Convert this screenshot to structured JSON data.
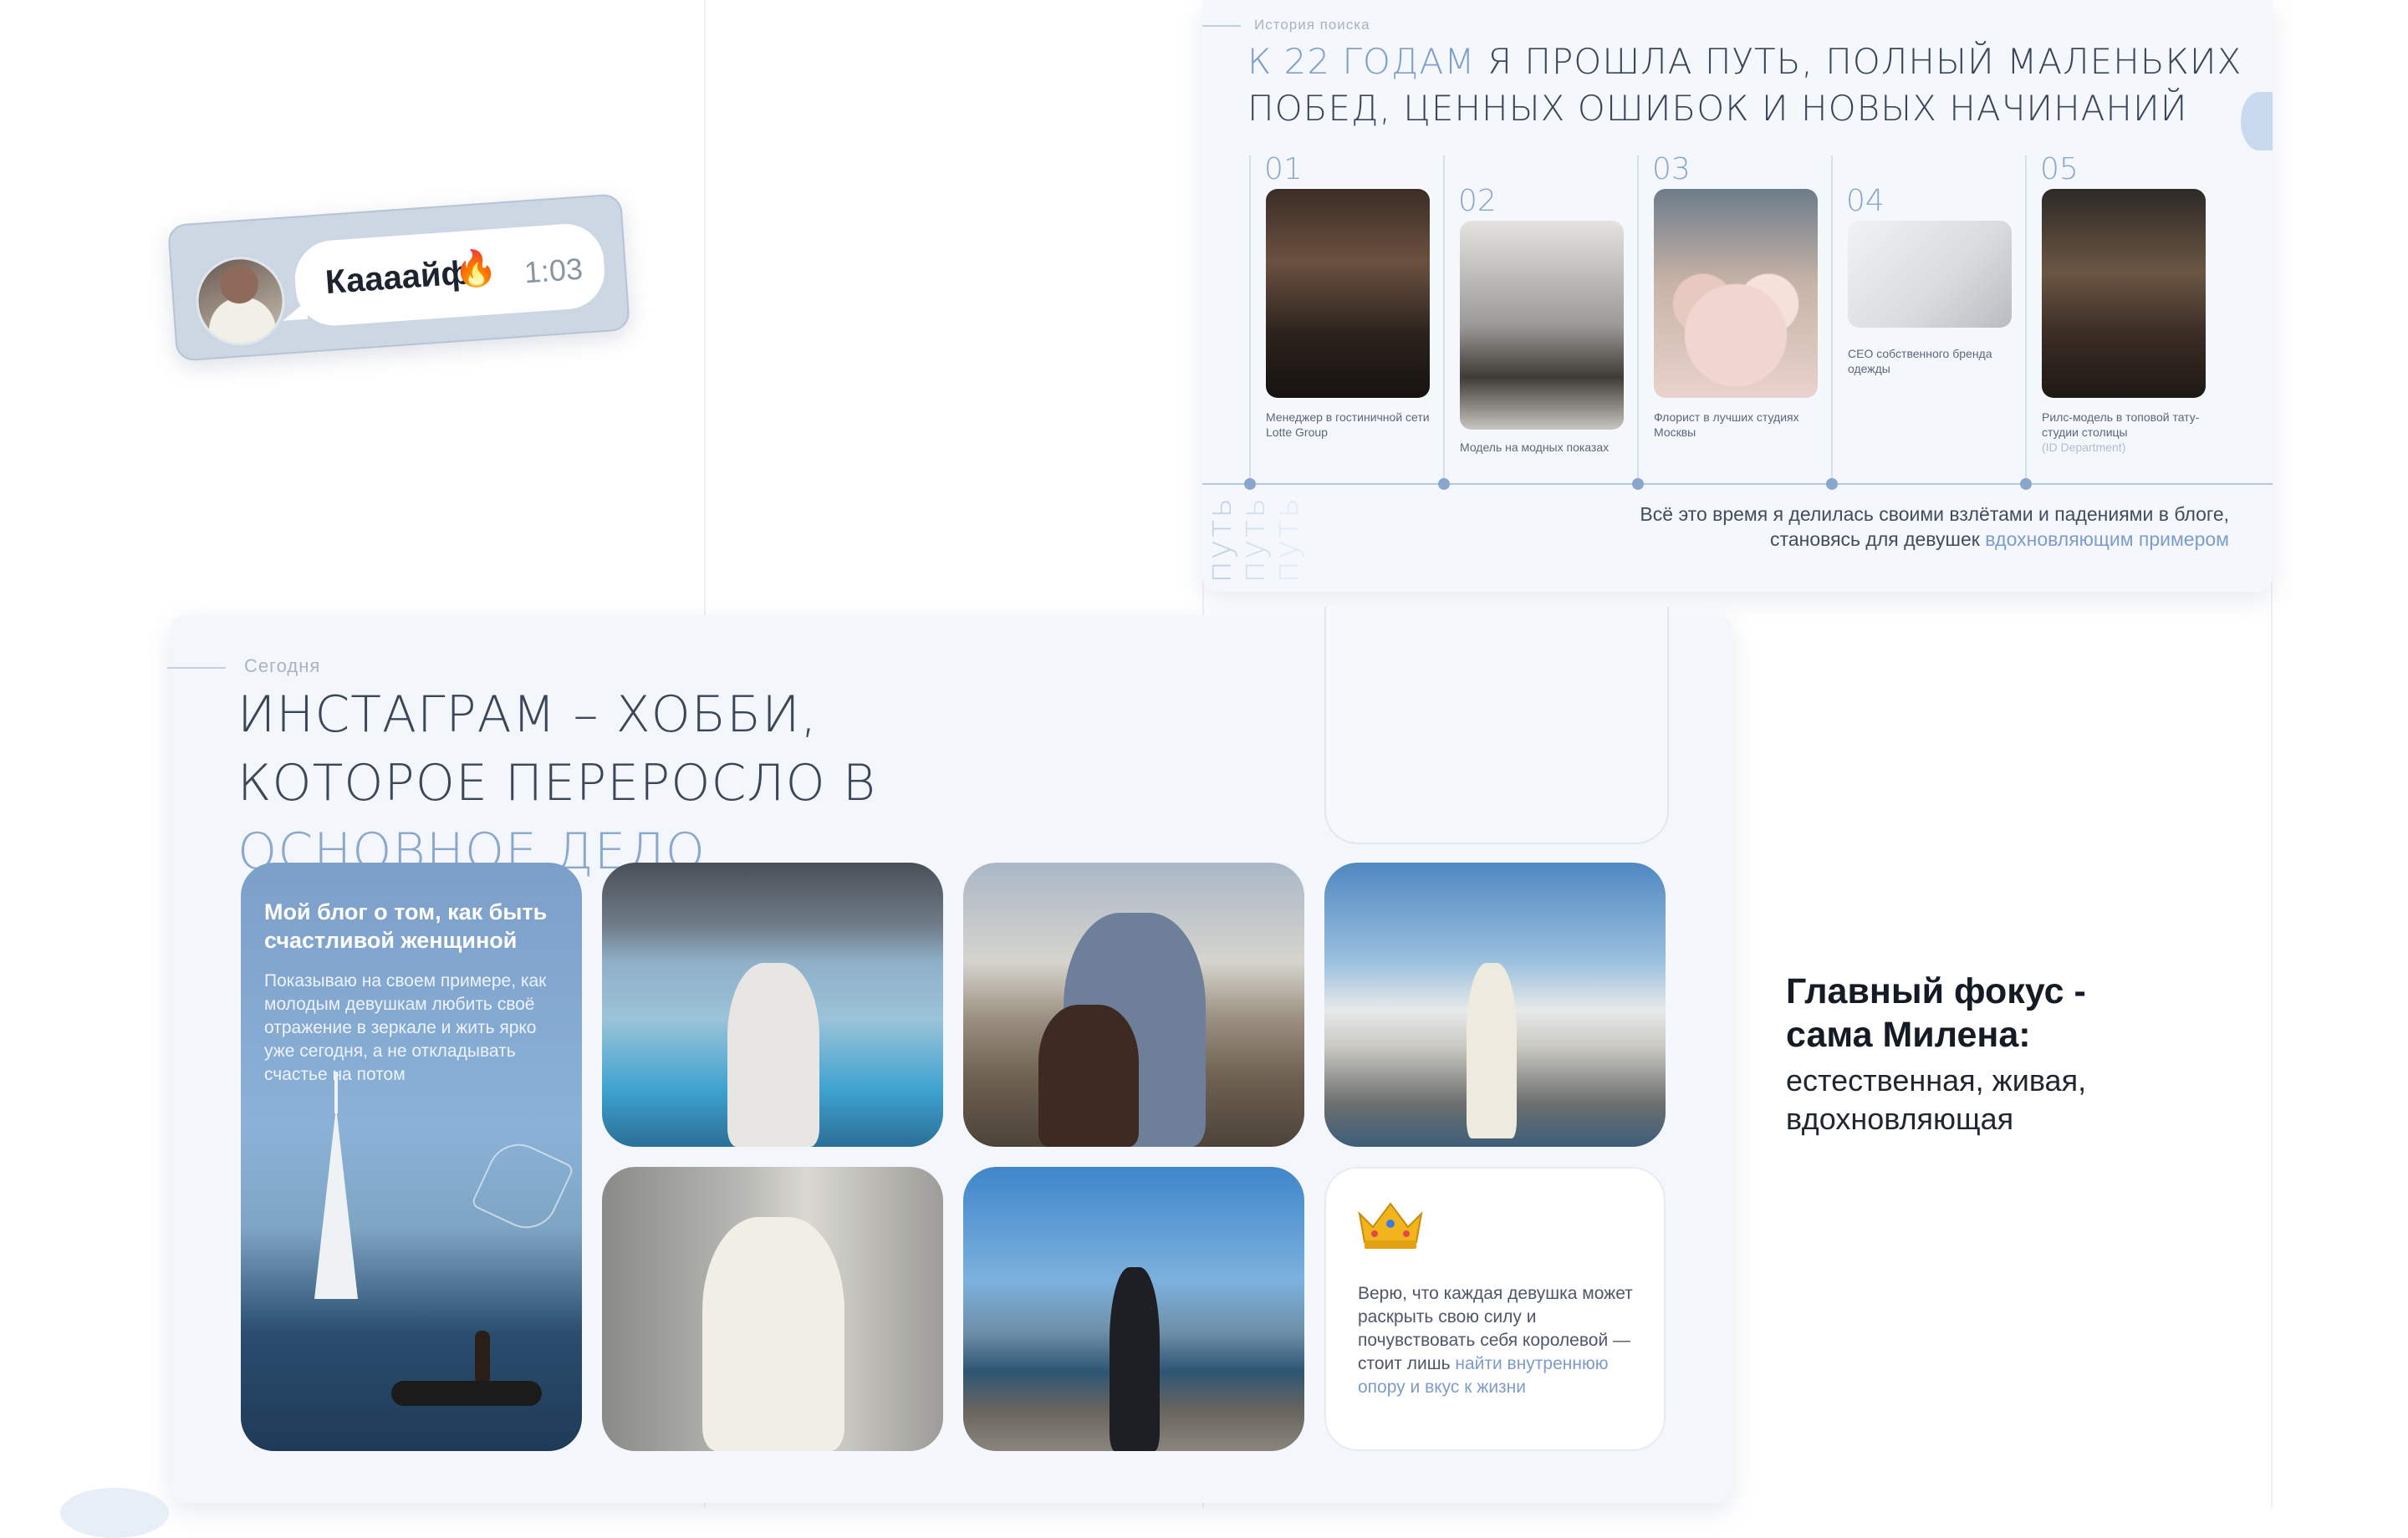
{
  "chat": {
    "message": "Каааайф",
    "emoji": "🔥",
    "time": "1:03"
  },
  "history": {
    "kicker": "История поиска",
    "title_accent": "К 22 годам",
    "title_rest": " я прошла путь, полный маленьких побед, ценных ошибок и новых начинаний",
    "steps": [
      {
        "num": "01",
        "caption": "Менеджер в гостиничной сети Lotte Group",
        "sub": ""
      },
      {
        "num": "02",
        "caption": "Модель на модных показах",
        "sub": ""
      },
      {
        "num": "03",
        "caption": "Флорист в лучших студиях Москвы",
        "sub": ""
      },
      {
        "num": "04",
        "caption": "CEO собственного бренда одежды",
        "sub": ""
      },
      {
        "num": "05",
        "caption": "Рилс-модель в топовой тату-студии столицы",
        "sub": "(ID Department)"
      }
    ],
    "vertical_word": "путь",
    "footer_line1": "Всё это время я делилась своими взлётами и падениями в блоге,",
    "footer_line2_plain": "становясь для девушек ",
    "footer_line2_accent": "вдохновляющим примером"
  },
  "today": {
    "kicker": "Сегодня",
    "title_plain": "Инстаграм – хобби, которое переросло в ",
    "title_accent": "основное дело",
    "blog_title": "Мой блог о том, как быть счастливой женщиной",
    "blog_text": "Показываю на своем примере, как молодым девушкам любить своё отражение в зеркале и жить ярко уже сегодня, а не откладывать счастье на потом",
    "crown_icon": "crown-icon",
    "crown_text_plain": "Верю, что каждая девушка может раскрыть свою силу и почувствовать себя королевой — стоит лишь ",
    "crown_text_accent": "найти внутреннюю опору и вкус к жизни"
  },
  "focus": {
    "title_line1": "Главный фокус -",
    "title_line2": "сама Милена:",
    "sub_line1": "естественная, живая,",
    "sub_line2": "вдохновляющая"
  },
  "colors": {
    "accent": "#7f9fc8",
    "card_bg": "#f3f6fb",
    "chat_card": "#ccd7e3",
    "text_dark": "#39465a"
  }
}
